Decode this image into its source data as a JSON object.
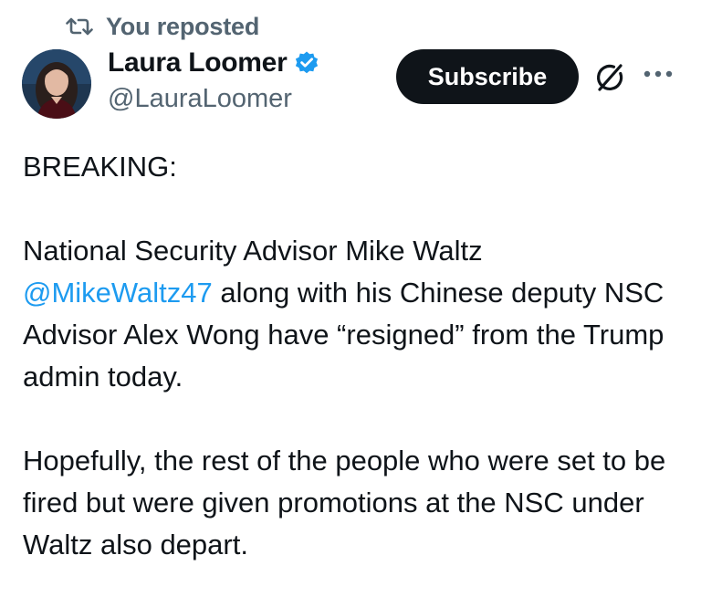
{
  "repost": {
    "icon": "repost-icon",
    "text": "You reposted"
  },
  "author": {
    "display_name": "Laura Loomer",
    "handle": "@LauraLoomer",
    "verified_icon": "verified-badge-icon",
    "verified_color": "#1d9bf0"
  },
  "actions": {
    "subscribe_label": "Subscribe",
    "grok_icon": "grok-icon",
    "more_icon": "more-options-icon"
  },
  "tweet": {
    "line1": "BREAKING:",
    "para2_start": "National Security Advisor Mike Waltz",
    "mention": "@MikeWaltz47",
    "para2_rest": " along with his Chinese deputy NSC Advisor Alex Wong have “resigned” from the Trump admin today.",
    "para3": "Hopefully, the rest of the people who were set to be fired but were given promotions at the NSC under Waltz also depart."
  },
  "colors": {
    "text": "#0f1419",
    "secondary": "#536471",
    "link": "#1d9bf0",
    "button_bg": "#0f1419",
    "button_text": "#ffffff"
  }
}
